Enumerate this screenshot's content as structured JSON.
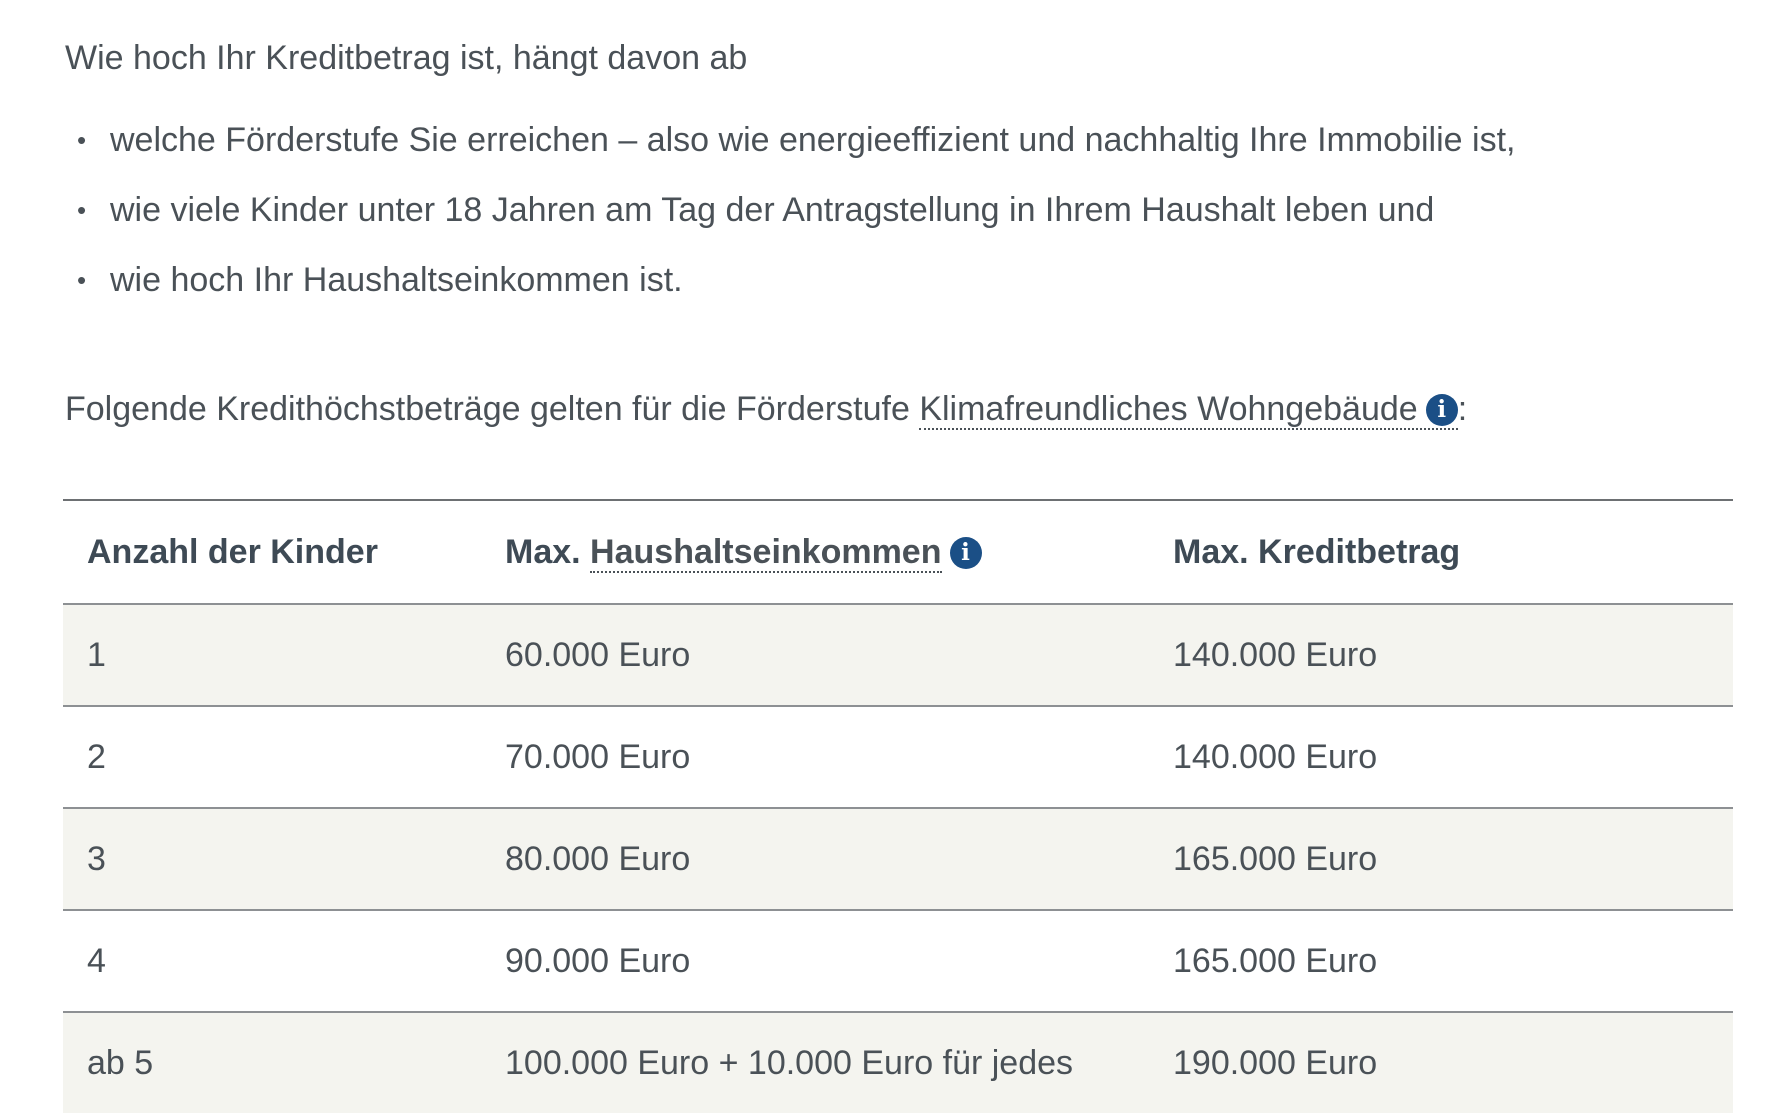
{
  "intro": {
    "text": "Wie hoch Ihr Kreditbetrag ist, hängt davon ab"
  },
  "bullets": [
    "welche Förderstufe Sie erreichen – also wie energieeffizient und nachhaltig Ihre Immobilie ist,",
    "wie viele Kinder unter 18 Jahren am Tag der Antragstellung in Ihrem Haushalt leben und",
    "wie hoch Ihr Haushaltseinkommen ist."
  ],
  "bullet_symbol": "•",
  "subline": {
    "prefix": "Folgende Kredithöchstbeträge gelten für die Förderstufe ",
    "term": "Klimafreundliches Wohngebäude",
    "suffix": ":"
  },
  "info_icon": {
    "name": "info-icon",
    "glyph": "i",
    "color": "#1b4f86"
  },
  "table": {
    "headers": {
      "col1": "Anzahl der Kinder",
      "col2_prefix": "Max. ",
      "col2_term": "Haushaltseinkommen",
      "col3": "Max. Kreditbetrag"
    },
    "rows": [
      {
        "kinder": "1",
        "einkommen": "60.000 Euro",
        "kredit": "140.000 Euro"
      },
      {
        "kinder": "2",
        "einkommen": "70.000 Euro",
        "kredit": "140.000 Euro"
      },
      {
        "kinder": "3",
        "einkommen": "80.000 Euro",
        "kredit": "165.000 Euro"
      },
      {
        "kinder": "4",
        "einkommen": "90.000 Euro",
        "kredit": "165.000 Euro"
      },
      {
        "kinder": "ab 5",
        "einkommen": "100.000 Euro + 10.000 Euro für jedes",
        "kredit": "190.000 Euro"
      }
    ]
  },
  "colors": {
    "text": "#4a5157",
    "header_text": "#3e4a55",
    "row_shade": "#f4f4ef",
    "rule": "#8d9093",
    "accent": "#1b4f86"
  }
}
